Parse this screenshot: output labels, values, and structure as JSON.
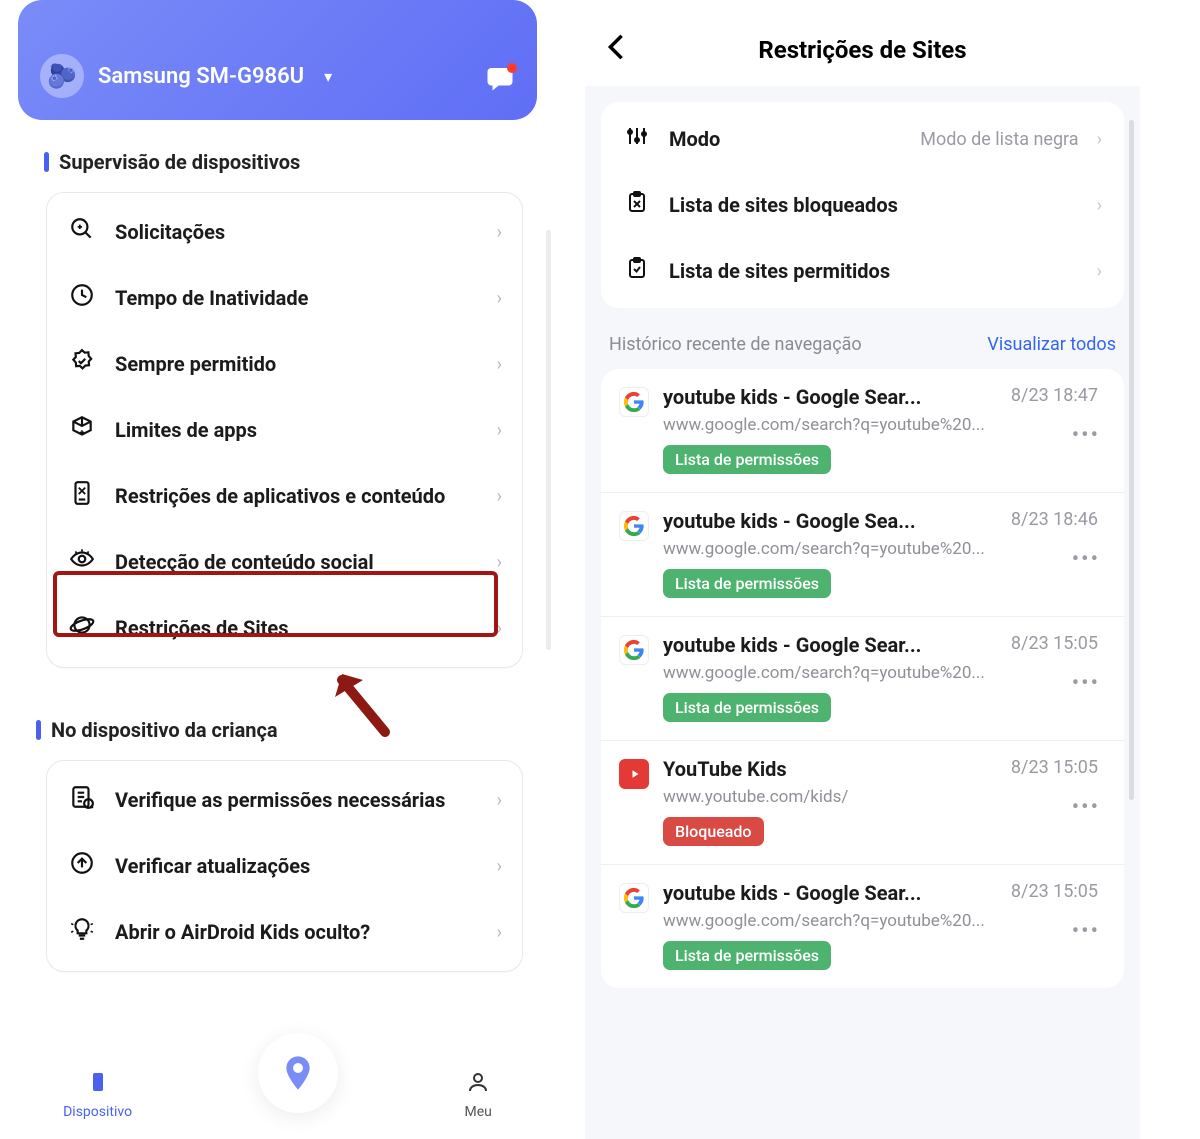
{
  "left": {
    "device_name": "Samsung SM-G986U",
    "sections": {
      "supervision": "Supervisão de dispositivos",
      "on_child": "No dispositivo da criança"
    },
    "items": {
      "requests": "Solicitações",
      "downtime": "Tempo de Inatividade",
      "always": "Sempre permitido",
      "applimits": "Limites de apps",
      "appcontent": "Restrições de aplicativos e conteúdo",
      "social": "Detecção de conteúdo social",
      "sites": "Restrições de Sites",
      "perms": "Verifique as permissões necessárias",
      "updates": "Verificar atualizações",
      "hidden": "Abrir o AirDroid Kids oculto?"
    },
    "nav": {
      "device": "Dispositivo",
      "me": "Meu"
    }
  },
  "right": {
    "title": "Restrições de Sites",
    "mode_label": "Modo",
    "mode_value": "Modo de lista negra",
    "blocked": "Lista de sites bloqueados",
    "allowed": "Lista de sites permitidos",
    "history_label": "Histórico recente de navegação",
    "view_all": "Visualizar todos",
    "badges": {
      "allow": "Lista de permissões",
      "block": "Bloqueado"
    },
    "history": [
      {
        "icon": "g",
        "title": "youtube kids - Google Sear...",
        "url": "www.google.com/search?q=youtube%20...",
        "time": "8/23 18:47",
        "status": "allow"
      },
      {
        "icon": "g",
        "title": "youtube kids - Google Sea...",
        "url": "www.google.com/search?q=youtube%20...",
        "time": "8/23 18:46",
        "status": "allow"
      },
      {
        "icon": "g",
        "title": "youtube kids - Google Sear...",
        "url": "www.google.com/search?q=youtube%20...",
        "time": "8/23 15:05",
        "status": "allow"
      },
      {
        "icon": "yt",
        "title": "YouTube Kids",
        "url": "www.youtube.com/kids/",
        "time": "8/23 15:05",
        "status": "block"
      },
      {
        "icon": "g",
        "title": "youtube kids - Google Sear...",
        "url": "www.google.com/search?q=youtube%20...",
        "time": "8/23 15:05",
        "status": "allow"
      }
    ]
  }
}
